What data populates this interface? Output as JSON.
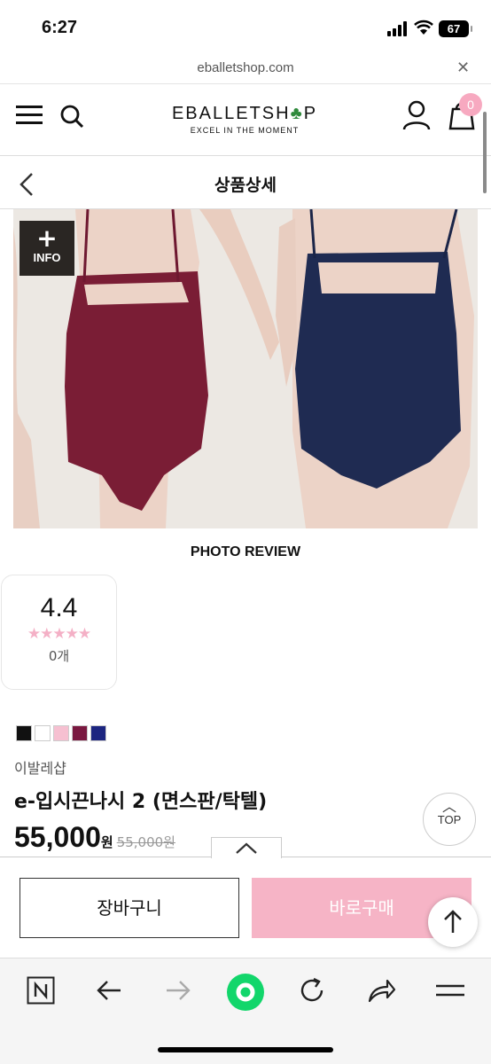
{
  "status_bar": {
    "time": "6:27",
    "battery": "67"
  },
  "url_bar": {
    "url": "eballetshop.com",
    "close_label": "✕"
  },
  "header": {
    "logo_text_a": "E",
    "logo_text_b": "BALLETSH",
    "logo_text_c": "P",
    "logo_clover": "♣",
    "logo_tagline": "EXCEL IN THE MOMENT",
    "cart_count": "0"
  },
  "title_bar": {
    "title": "상품상세"
  },
  "image": {
    "info_plus": "+",
    "info_label": "INFO"
  },
  "review": {
    "heading": "PHOTO REVIEW",
    "score": "4.4",
    "stars": "★★★★★",
    "count": "0개"
  },
  "colors": {
    "swatches": [
      "#111111",
      "#ffffff",
      "#f6c0d1",
      "#7a1840",
      "#1c2580"
    ],
    "accent_pink": "#f6b4c6"
  },
  "product": {
    "brand": "이발레샵",
    "name": "e-입시끈나시 2 (면스판/탁텔)",
    "price": "55,000",
    "price_unit": "원",
    "original_price": "55,000원"
  },
  "actions": {
    "top_label": "TOP",
    "cart_label": "장바구니",
    "buy_label": "바로구매"
  },
  "icons": [
    "search-icon",
    "menu-icon",
    "user-icon",
    "cart-icon",
    "back-icon",
    "n-icon",
    "back-arrow-icon",
    "forward-arrow-icon",
    "green-home-icon",
    "reload-icon",
    "share-icon",
    "tabs-menu-icon"
  ]
}
